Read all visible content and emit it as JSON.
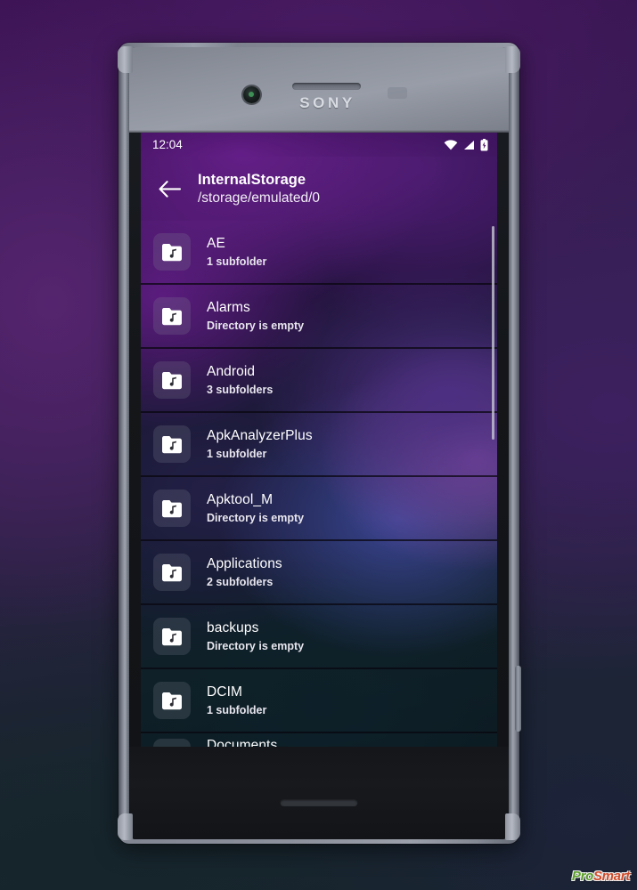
{
  "device": {
    "brand": "SONY",
    "frame_color": "#8d929d",
    "icons": {
      "front_camera": "front-camera",
      "earpiece": "earpiece-speaker",
      "bottom_speaker": "bottom-speaker",
      "power_button": "power-button"
    }
  },
  "status_bar": {
    "time": "12:04",
    "icons": [
      "wifi-icon",
      "signal-icon",
      "battery-charging-icon"
    ]
  },
  "app_bar": {
    "back_icon": "back-arrow-icon",
    "title": "InternalStorage",
    "subtitle": "/storage/emulated/0"
  },
  "list": {
    "folder_icon_name": "music-folder-icon",
    "items": [
      {
        "name": "AE",
        "meta": "1 subfolder"
      },
      {
        "name": "Alarms",
        "meta": "Directory is empty"
      },
      {
        "name": "Android",
        "meta": "3 subfolders"
      },
      {
        "name": "ApkAnalyzerPlus",
        "meta": "1 subfolder"
      },
      {
        "name": "Apktool_M",
        "meta": "Directory is empty"
      },
      {
        "name": "Applications",
        "meta": "2 subfolders"
      },
      {
        "name": "backups",
        "meta": "Directory is empty"
      },
      {
        "name": "DCIM",
        "meta": "1 subfolder"
      },
      {
        "name": "Documents",
        "meta": ""
      }
    ]
  },
  "scrollbar": {
    "name": "vertical-scrollbar"
  },
  "watermark": {
    "pro": "Pro",
    "smart": "Smart"
  },
  "colors": {
    "accent_purple": "#5b1c7e",
    "screen_dark": "#101419",
    "text_primary": "#ffffff",
    "watermark_green": "#5a9e28",
    "watermark_red": "#d14b2a"
  }
}
